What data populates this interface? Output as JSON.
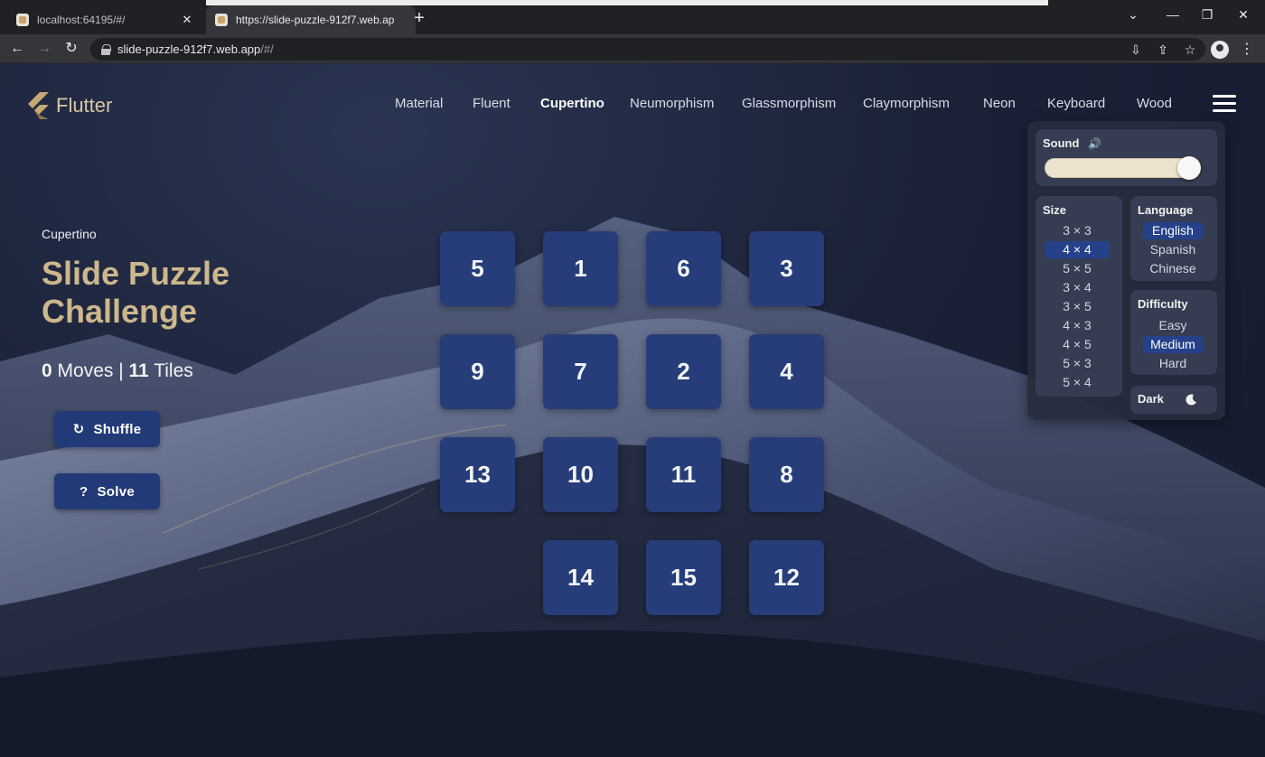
{
  "browser": {
    "tabs": [
      {
        "title": "localhost:64195/#/"
      },
      {
        "title": "https://slide-puzzle-912f7.web.ap"
      }
    ],
    "new_tab_label": "+",
    "close_label": "✕",
    "url_host": "slide-puzzle-912f7.web.app",
    "url_path": "/#/"
  },
  "app": {
    "logo_text": "Flutter",
    "nav": [
      "Material",
      "Fluent",
      "Cupertino",
      "Neumorphism",
      "Glassmorphism",
      "Claymorphism",
      "Neon",
      "Keyboard",
      "Wood"
    ],
    "active_nav": "Cupertino"
  },
  "info": {
    "subtitle": "Cupertino",
    "title": "Slide Puzzle Challenge",
    "moves": "0",
    "moves_label": "Moves |",
    "tiles": "11",
    "tiles_label": "Tiles",
    "shuffle_label": "Shuffle",
    "solve_label": "Solve"
  },
  "board": {
    "size": "4 × 4",
    "tiles": [
      "5",
      "1",
      "6",
      "3",
      "9",
      "7",
      "2",
      "4",
      "13",
      "10",
      "11",
      "8",
      "",
      "14",
      "15",
      "12"
    ]
  },
  "settings": {
    "sound_label": "Sound",
    "sound_volume": 0.95,
    "size_label": "Size",
    "sizes": [
      "3 × 3",
      "4 × 4",
      "5 × 5",
      "3 × 4",
      "3 × 5",
      "4 × 3",
      "4 × 5",
      "5 × 3",
      "5 × 4"
    ],
    "size_selected": "4 × 4",
    "language_label": "Language",
    "languages": [
      "English",
      "Spanish",
      "Chinese"
    ],
    "language_selected": "English",
    "difficulty_label": "Difficulty",
    "difficulties": [
      "Easy",
      "Medium",
      "Hard"
    ],
    "difficulty_selected": "Medium",
    "dark_label": "Dark"
  }
}
